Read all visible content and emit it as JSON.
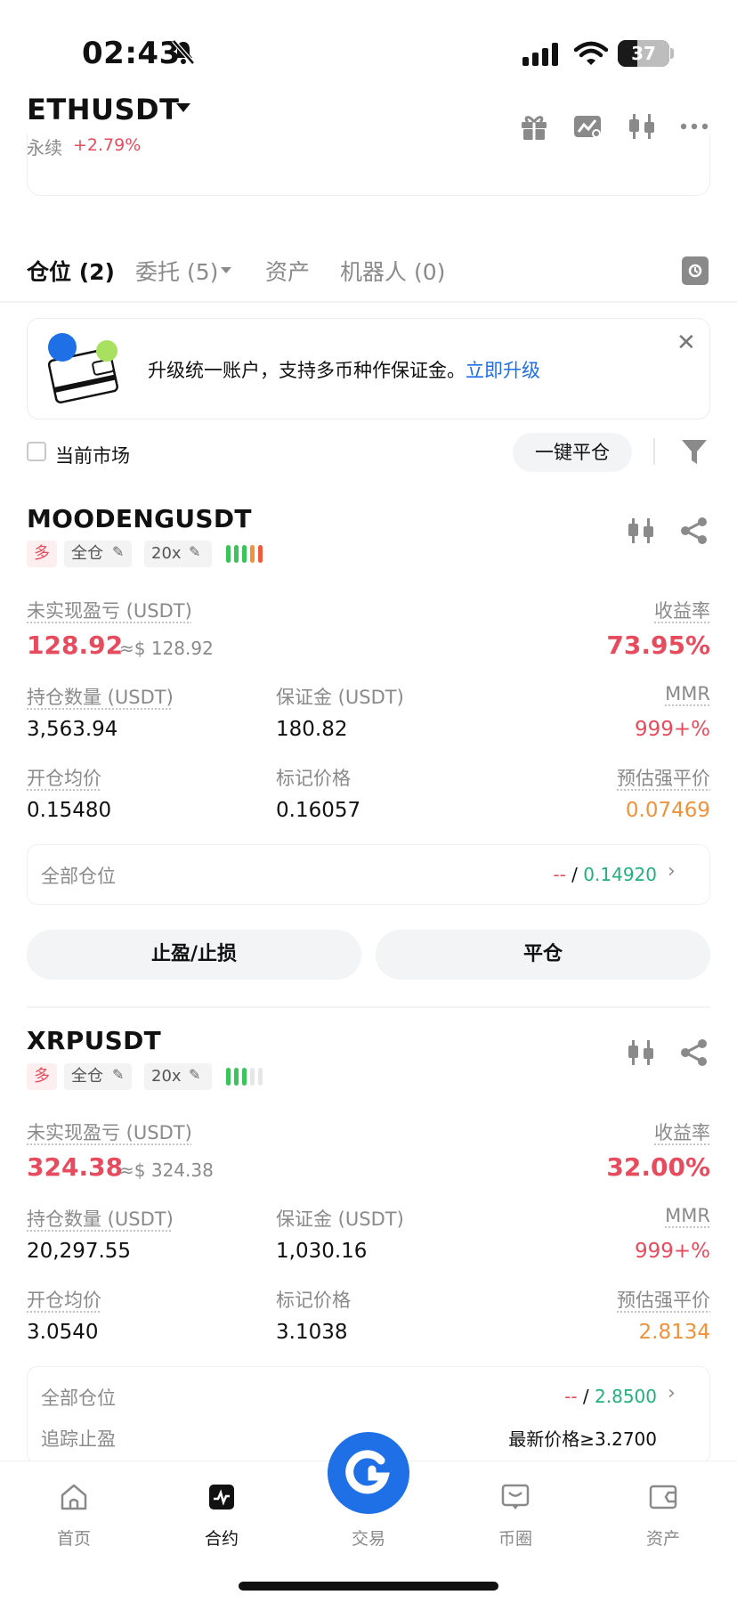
{
  "status_bar": {
    "time": "02:43",
    "battery": "37"
  },
  "header": {
    "pair": "ETHUSDT",
    "contract_type": "永续",
    "change": "+2.79%"
  },
  "tabs": [
    {
      "label": "仓位 (2)"
    },
    {
      "label": "委托 (5)"
    },
    {
      "label": "资产"
    },
    {
      "label": "机器人 (0)"
    }
  ],
  "banner": {
    "text": "升级统一账户，支持多币种作保证金。",
    "link": "立即升级"
  },
  "filter": {
    "current_market": "当前市场",
    "close_all": "一键平仓"
  },
  "labels": {
    "unrealized": "未实现盈亏 (USDT)",
    "roe": "收益率",
    "size": "持仓数量 (USDT)",
    "margin": "保证金 (USDT)",
    "mmr": "MMR",
    "entry": "开仓均价",
    "mark": "标记价格",
    "liq": "预估强平价",
    "all_positions": "全部仓位",
    "tp_sl": "止盈/止损",
    "close": "平仓",
    "trailing": "追踪止盈"
  },
  "positions": [
    {
      "symbol": "MOODENGUSDT",
      "side": "多",
      "mode": "全仓",
      "leverage": "20x",
      "pnl": "128.92",
      "pnl_usd": "≈$ 128.92",
      "roe": "73.95%",
      "size": "3,563.94",
      "margin": "180.82",
      "mmr": "999+%",
      "entry": "0.15480",
      "mark": "0.16057",
      "liq": "0.07469",
      "tp": "--",
      "sl": "0.14920"
    },
    {
      "symbol": "XRPUSDT",
      "side": "多",
      "mode": "全仓",
      "leverage": "20x",
      "pnl": "324.38",
      "pnl_usd": "≈$ 324.38",
      "roe": "32.00%",
      "size": "20,297.55",
      "margin": "1,030.16",
      "mmr": "999+%",
      "entry": "3.0540",
      "mark": "3.1038",
      "liq": "2.8134",
      "tp": "--",
      "sl": "2.8500",
      "trailing_value": "最新价格≥3.2700"
    }
  ],
  "nav": [
    {
      "label": "首页",
      "icon": "home-icon"
    },
    {
      "label": "合约",
      "icon": "futures-icon"
    },
    {
      "label": "交易",
      "icon": "trade-icon"
    },
    {
      "label": "币圈",
      "icon": "feed-icon"
    },
    {
      "label": "资产",
      "icon": "wallet-icon"
    }
  ],
  "colors": {
    "accent": "#1f6fe6",
    "up": "#e74c5e",
    "down": "#22b07d",
    "warn": "#f0923b"
  }
}
